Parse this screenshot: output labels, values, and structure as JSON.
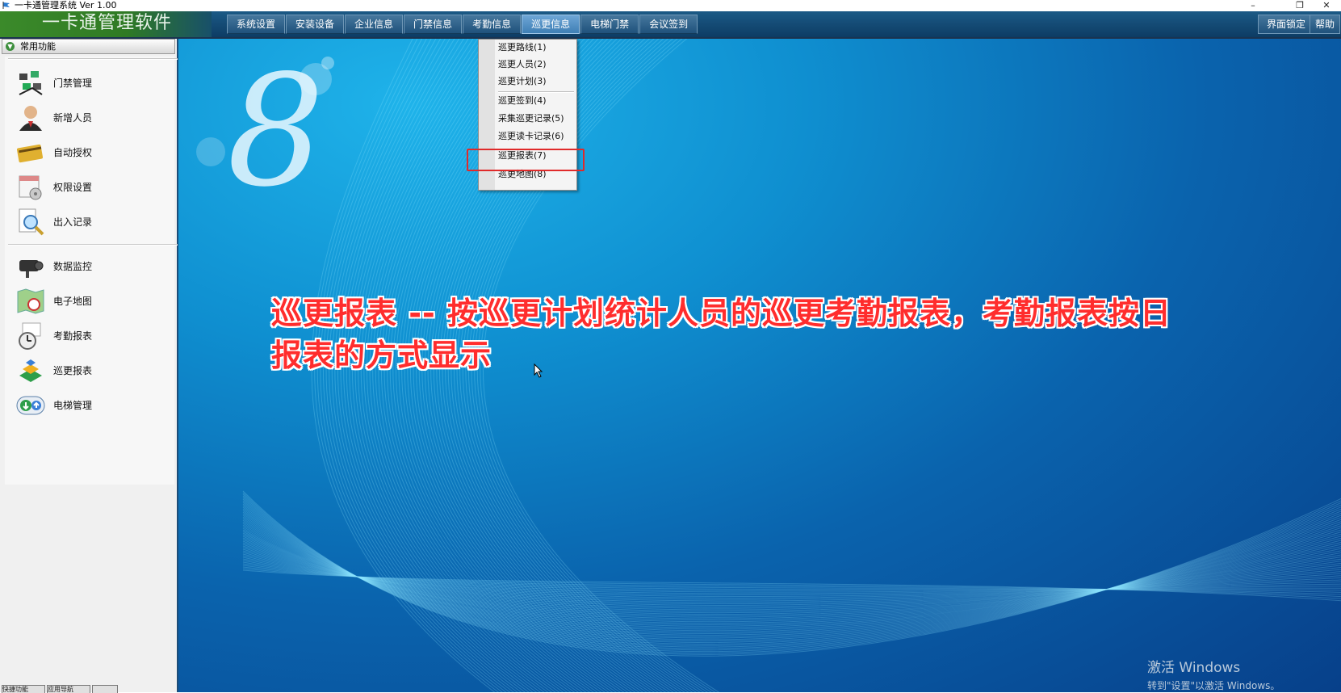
{
  "window": {
    "title": "一卡通管理系统  Ver 1.00",
    "controls": {
      "minimize": "–",
      "restore": "❐",
      "close": "✕"
    }
  },
  "header": {
    "brand": "一卡通管理软件",
    "menu": [
      {
        "label": "系统设置"
      },
      {
        "label": "安装设备"
      },
      {
        "label": "企业信息"
      },
      {
        "label": "门禁信息"
      },
      {
        "label": "考勤信息"
      },
      {
        "label": "巡更信息",
        "active": true
      },
      {
        "label": "电梯门禁"
      },
      {
        "label": "会议签到"
      }
    ],
    "right": {
      "lock": "界面锁定",
      "help": "帮助"
    }
  },
  "sidebar": {
    "section": "常用功能",
    "group1": [
      {
        "label": "门禁管理",
        "icon": "access-control-icon"
      },
      {
        "label": "新增人员",
        "icon": "user-add-icon"
      },
      {
        "label": "自动授权",
        "icon": "card-auth-icon"
      },
      {
        "label": "权限设置",
        "icon": "calendar-settings-icon"
      },
      {
        "label": "出入记录",
        "icon": "record-search-icon"
      }
    ],
    "group2": [
      {
        "label": "数据监控",
        "icon": "camera-monitor-icon"
      },
      {
        "label": "电子地图",
        "icon": "map-icon"
      },
      {
        "label": "考勤报表",
        "icon": "attendance-clock-icon"
      },
      {
        "label": "巡更报表",
        "icon": "patrol-report-icon"
      },
      {
        "label": "电梯管理",
        "icon": "elevator-icon"
      }
    ],
    "bottom_tabs": [
      "快捷功能",
      "应用导航",
      ""
    ]
  },
  "dropdown": {
    "items": [
      {
        "label": "巡更路线(1)"
      },
      {
        "label": "巡更人员(2)"
      },
      {
        "label": "巡更计划(3)"
      },
      {
        "label": "巡更签到(4)"
      },
      {
        "label": "采集巡更记录(5)"
      },
      {
        "label": "巡更读卡记录(6)"
      },
      {
        "label": "巡更报表(7)",
        "highlighted": true
      },
      {
        "label": "巡更地图(8)"
      }
    ]
  },
  "caption": "巡更报表 -- 按巡更计划统计人员的巡更考勤报表，考勤报表按日报表的方式显示",
  "watermark": {
    "line1": "激活 Windows",
    "line2": "转到\"设置\"以激活 Windows。"
  },
  "colors": {
    "caption": "#ff2d2d",
    "highlight_box": "#e02a2a",
    "desktop": "#0a63ad"
  }
}
